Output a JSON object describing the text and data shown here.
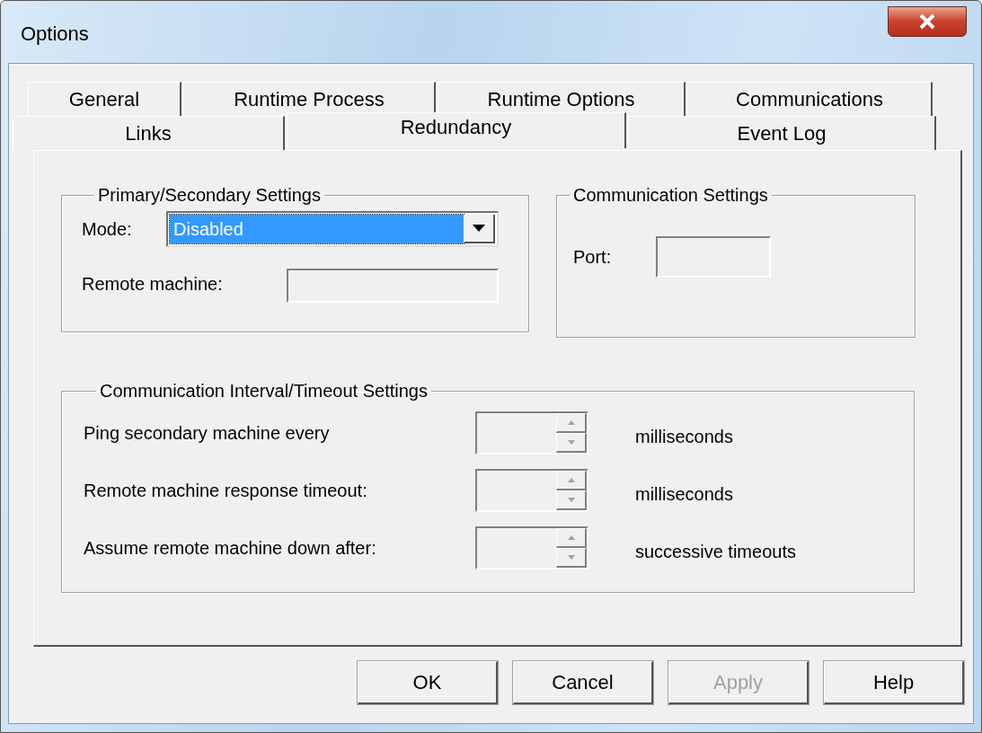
{
  "window": {
    "title": "Options"
  },
  "tab_rows": [
    {
      "tabs": [
        {
          "label": "General",
          "selected": false
        },
        {
          "label": "Runtime Process",
          "selected": false
        },
        {
          "label": "Runtime Options",
          "selected": false
        },
        {
          "label": "Communications",
          "selected": false
        }
      ]
    },
    {
      "tabs": [
        {
          "label": "Links",
          "selected": false
        },
        {
          "label": "Redundancy",
          "selected": true
        },
        {
          "label": "Event Log",
          "selected": false
        }
      ]
    }
  ],
  "primary_secondary": {
    "title": "Primary/Secondary Settings",
    "mode": {
      "label": "Mode:",
      "value": "Disabled",
      "focused": true
    },
    "remote_machine": {
      "label": "Remote machine:",
      "disabled": true
    }
  },
  "communication_settings": {
    "title": "Communication Settings",
    "port": {
      "label": "Port:",
      "disabled": true
    }
  },
  "interval_settings": {
    "title": "Communication Interval/Timeout Settings",
    "rows": [
      {
        "label": "Ping secondary machine every",
        "unit": "milliseconds",
        "disabled": true
      },
      {
        "label": "Remote machine response timeout:",
        "unit": "milliseconds",
        "disabled": true
      },
      {
        "label": "Assume remote machine down after:",
        "unit": "successive timeouts",
        "disabled": true
      }
    ]
  },
  "buttons": [
    {
      "label": "OK",
      "disabled": false
    },
    {
      "label": "Cancel",
      "disabled": false
    },
    {
      "label": "Apply",
      "disabled": true
    },
    {
      "label": "Help",
      "disabled": false
    }
  ]
}
